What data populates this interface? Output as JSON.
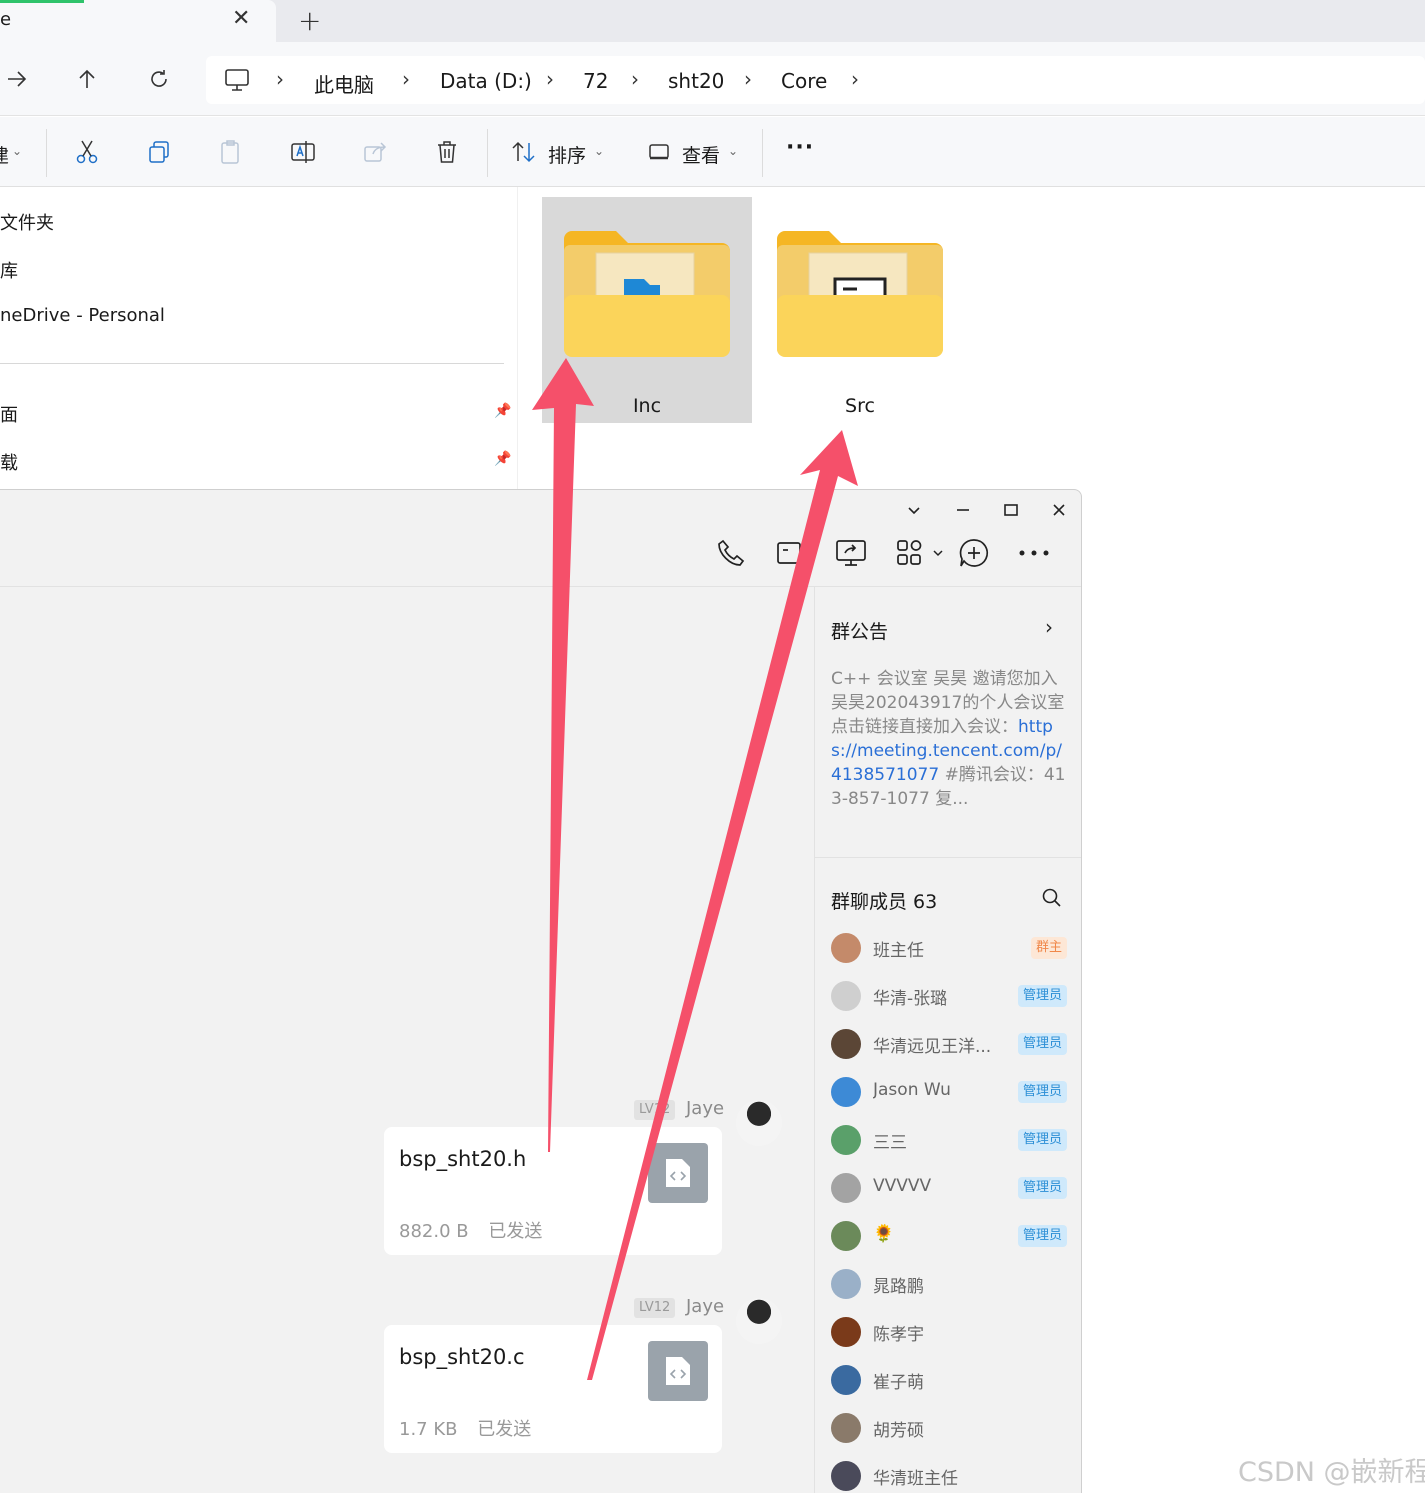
{
  "explorer": {
    "tab": {
      "title": "e",
      "close_glyph": "✕"
    },
    "new_tab_glyph": "+",
    "breadcrumb": [
      "此电脑",
      "Data (D:)",
      "72",
      "sht20",
      "Core"
    ],
    "toolbar": {
      "new_caret": "建",
      "sort_label": "排序",
      "view_label": "查看",
      "more": "···"
    },
    "nav_items": [
      "文件夹",
      "库",
      "neDrive - Personal",
      "面",
      "载"
    ],
    "folders": [
      {
        "name": "Inc",
        "selected": true
      },
      {
        "name": "Src",
        "selected": false
      }
    ]
  },
  "chat": {
    "notice": {
      "title": "群公告",
      "text_before": "C++ 会议室 吴昊 邀请您加入吴昊202043917的个人会议室 点击链接直接加入会议：",
      "link": "https://meeting.tencent.com/p/4138571077",
      "text_after": " #腾讯会议：413-857-1077 复..."
    },
    "members_title": "群聊成员 63",
    "members": [
      {
        "name": "班主任",
        "badge": "群主",
        "role": "owner",
        "avatar_color": "#c48a6a"
      },
      {
        "name": "华清-张璐",
        "badge": "管理员",
        "role": "admin",
        "avatar_color": "#cfcfcf"
      },
      {
        "name": "华清远见王洋...",
        "badge": "管理员",
        "role": "admin",
        "avatar_color": "#5b4636"
      },
      {
        "name": "Jason Wu",
        "badge": "管理员",
        "role": "admin",
        "avatar_color": "#3d8ad6"
      },
      {
        "name": "三三",
        "badge": "管理员",
        "role": "admin",
        "avatar_color": "#5aa06a"
      },
      {
        "name": "VVVVV",
        "badge": "管理员",
        "role": "admin",
        "avatar_color": "#a3a3a3"
      },
      {
        "name": "🌻",
        "badge": "管理员",
        "role": "admin",
        "avatar_color": "#6b8a5a"
      },
      {
        "name": "晁路鹏",
        "badge": "",
        "role": "",
        "avatar_color": "#9ab0c8"
      },
      {
        "name": "陈孝宇",
        "badge": "",
        "role": "",
        "avatar_color": "#7a3a1a"
      },
      {
        "name": "崔子萌",
        "badge": "",
        "role": "",
        "avatar_color": "#3a6aa0"
      },
      {
        "name": "胡芳硕",
        "badge": "",
        "role": "",
        "avatar_color": "#8a7a6a"
      },
      {
        "name": "华清班主任",
        "badge": "",
        "role": "",
        "avatar_color": "#4a4a5a"
      }
    ],
    "messages": [
      {
        "level": "LV12",
        "sender": "Jaye",
        "file_name": "bsp_sht20.h",
        "size": "882.0 B",
        "status": "已发送"
      },
      {
        "level": "LV12",
        "sender": "Jaye",
        "file_name": "bsp_sht20.c",
        "size": "1.7 KB",
        "status": "已发送"
      }
    ]
  },
  "watermark": "CSDN @嵌新程",
  "colors": {
    "arrow": "#f5506a",
    "folder": "#f8c94d",
    "link": "#2a6fd6"
  }
}
